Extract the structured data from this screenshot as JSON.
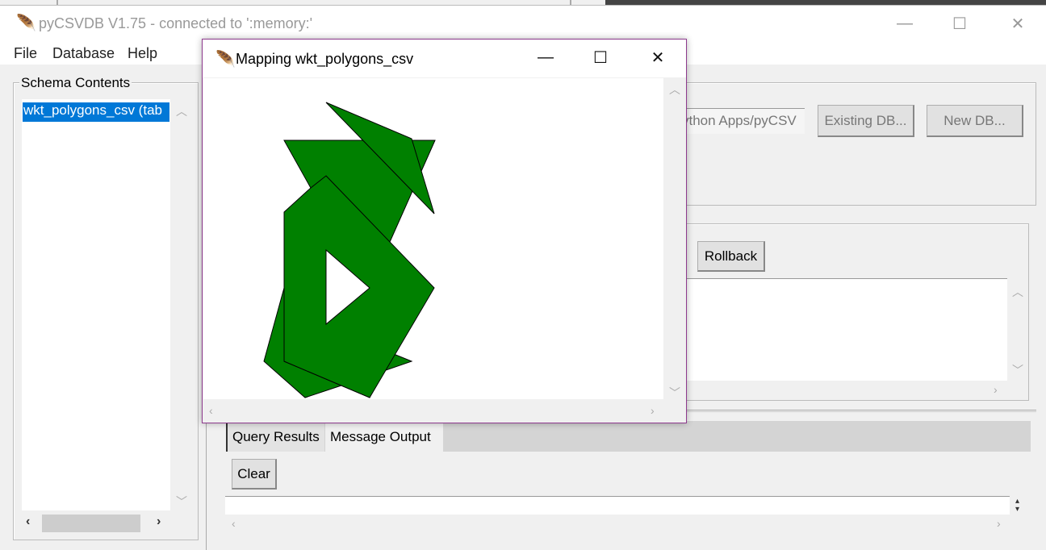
{
  "main_window": {
    "title": "pyCSVDB V1.75 - connected to ':memory:'",
    "controls": {
      "minimize": "—",
      "maximize": "☐",
      "close": "✕"
    }
  },
  "menu": [
    "File",
    "Database",
    "Help"
  ],
  "schema": {
    "label": "Schema Contents",
    "items": [
      "wkt_polygons_csv (tab"
    ]
  },
  "db_panel": {
    "path_value": "ython Apps/pyCSV",
    "existing_db": "Existing DB...",
    "new_db": "New DB..."
  },
  "sql_panel": {
    "rollback": "Rollback"
  },
  "tabs": [
    "Query Results",
    "Message Output"
  ],
  "active_tab": "Message Output",
  "output": {
    "clear": "Clear"
  },
  "popup": {
    "title": "Mapping wkt_polygons_csv",
    "controls": {
      "minimize": "—",
      "maximize": "☐",
      "close": "✕"
    },
    "fill_color": "#008000",
    "stroke_color": "#000000"
  }
}
